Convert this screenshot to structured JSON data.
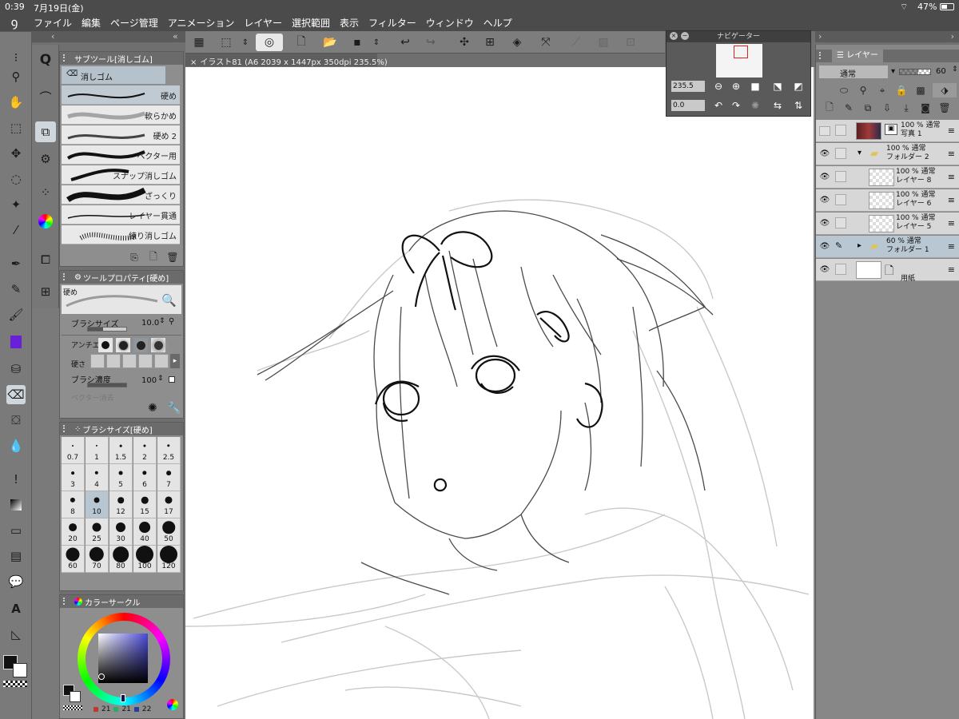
{
  "status": {
    "time": "0:39",
    "date": "7月19日(金)",
    "wifi_icon": "wifi-icon",
    "battery": "47%"
  },
  "menu": {
    "items": [
      "ファイル",
      "編集",
      "ページ管理",
      "アニメーション",
      "レイヤー",
      "選択範囲",
      "表示",
      "フィルター",
      "ウィンドウ",
      "ヘルプ"
    ]
  },
  "document": {
    "tab_title": "イラスト81 (A6 2039 x 1447px 350dpi 235.5%)"
  },
  "subtool": {
    "title": "サブツール[消しゴム]",
    "group": "消しゴム",
    "brushes": [
      "硬め",
      "軟らかめ",
      "硬め 2",
      "ベクター用",
      "スナップ消しゴム",
      "ざっくり",
      "レイヤー貫通",
      "練り消しゴム"
    ],
    "selected": 0
  },
  "toolprop": {
    "title": "ツールプロパティ[硬め]",
    "preset": "硬め",
    "brush_size_label": "ブラシサイズ",
    "brush_size_value": "10.0",
    "antialias_label": "アンチエ",
    "hardness_label": "硬さ",
    "density_label": "ブラシ濃度",
    "density_value": "100",
    "hidden_label": "ベクター消去"
  },
  "brushsize": {
    "title": "ブラシサイズ[硬め]",
    "sizes": [
      "0.7",
      "1",
      "1.5",
      "2",
      "2.5",
      "3",
      "4",
      "5",
      "6",
      "7",
      "8",
      "10",
      "12",
      "15",
      "17",
      "20",
      "25",
      "30",
      "40",
      "50",
      "60",
      "70",
      "80",
      "100",
      "120"
    ],
    "selected": "10"
  },
  "colorcircle": {
    "title": "カラーサークル",
    "r": "21",
    "g": "21",
    "b": "22"
  },
  "navigator": {
    "title": "ナビゲーター",
    "zoom": "235.5",
    "rotate": "0.0"
  },
  "layers": {
    "title": "レイヤー",
    "blend": "通常",
    "opacity": "60",
    "rows": [
      {
        "line1": "100 % 通常",
        "line2": "写真 1",
        "visible": false,
        "kind": "photo"
      },
      {
        "line1": "100 % 通常",
        "line2": "フォルダー 2",
        "visible": true,
        "kind": "folder-open"
      },
      {
        "line1": "100 % 通常",
        "line2": "レイヤー 8",
        "visible": true,
        "kind": "raster"
      },
      {
        "line1": "100 % 通常",
        "line2": "レイヤー 6",
        "visible": true,
        "kind": "raster"
      },
      {
        "line1": "100 % 通常",
        "line2": "レイヤー 5",
        "visible": true,
        "kind": "raster"
      },
      {
        "line1": "60 % 通常",
        "line2": "フォルダー 1",
        "visible": true,
        "kind": "folder-closed",
        "selected": true
      },
      {
        "line1": "",
        "line2": "用紙",
        "visible": true,
        "kind": "paper"
      }
    ]
  },
  "colors": {
    "ui_dark": "#4b4b4b",
    "accent_select": "#b9c7d2",
    "main_color": "#111111",
    "sub_color": "#ffffff"
  }
}
